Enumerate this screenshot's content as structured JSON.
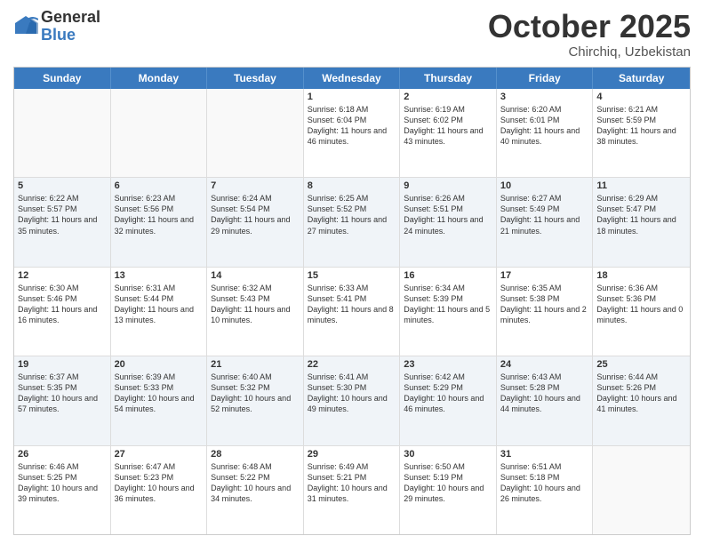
{
  "logo": {
    "general": "General",
    "blue": "Blue"
  },
  "header": {
    "month": "October 2025",
    "location": "Chirchiq, Uzbekistan"
  },
  "days": [
    "Sunday",
    "Monday",
    "Tuesday",
    "Wednesday",
    "Thursday",
    "Friday",
    "Saturday"
  ],
  "rows": [
    [
      {
        "day": "",
        "empty": true
      },
      {
        "day": "",
        "empty": true
      },
      {
        "day": "",
        "empty": true
      },
      {
        "day": "1",
        "sunrise": "6:18 AM",
        "sunset": "6:04 PM",
        "daylight": "11 hours and 46 minutes."
      },
      {
        "day": "2",
        "sunrise": "6:19 AM",
        "sunset": "6:02 PM",
        "daylight": "11 hours and 43 minutes."
      },
      {
        "day": "3",
        "sunrise": "6:20 AM",
        "sunset": "6:01 PM",
        "daylight": "11 hours and 40 minutes."
      },
      {
        "day": "4",
        "sunrise": "6:21 AM",
        "sunset": "5:59 PM",
        "daylight": "11 hours and 38 minutes."
      }
    ],
    [
      {
        "day": "5",
        "sunrise": "6:22 AM",
        "sunset": "5:57 PM",
        "daylight": "11 hours and 35 minutes."
      },
      {
        "day": "6",
        "sunrise": "6:23 AM",
        "sunset": "5:56 PM",
        "daylight": "11 hours and 32 minutes."
      },
      {
        "day": "7",
        "sunrise": "6:24 AM",
        "sunset": "5:54 PM",
        "daylight": "11 hours and 29 minutes."
      },
      {
        "day": "8",
        "sunrise": "6:25 AM",
        "sunset": "5:52 PM",
        "daylight": "11 hours and 27 minutes."
      },
      {
        "day": "9",
        "sunrise": "6:26 AM",
        "sunset": "5:51 PM",
        "daylight": "11 hours and 24 minutes."
      },
      {
        "day": "10",
        "sunrise": "6:27 AM",
        "sunset": "5:49 PM",
        "daylight": "11 hours and 21 minutes."
      },
      {
        "day": "11",
        "sunrise": "6:29 AM",
        "sunset": "5:47 PM",
        "daylight": "11 hours and 18 minutes."
      }
    ],
    [
      {
        "day": "12",
        "sunrise": "6:30 AM",
        "sunset": "5:46 PM",
        "daylight": "11 hours and 16 minutes."
      },
      {
        "day": "13",
        "sunrise": "6:31 AM",
        "sunset": "5:44 PM",
        "daylight": "11 hours and 13 minutes."
      },
      {
        "day": "14",
        "sunrise": "6:32 AM",
        "sunset": "5:43 PM",
        "daylight": "11 hours and 10 minutes."
      },
      {
        "day": "15",
        "sunrise": "6:33 AM",
        "sunset": "5:41 PM",
        "daylight": "11 hours and 8 minutes."
      },
      {
        "day": "16",
        "sunrise": "6:34 AM",
        "sunset": "5:39 PM",
        "daylight": "11 hours and 5 minutes."
      },
      {
        "day": "17",
        "sunrise": "6:35 AM",
        "sunset": "5:38 PM",
        "daylight": "11 hours and 2 minutes."
      },
      {
        "day": "18",
        "sunrise": "6:36 AM",
        "sunset": "5:36 PM",
        "daylight": "11 hours and 0 minutes."
      }
    ],
    [
      {
        "day": "19",
        "sunrise": "6:37 AM",
        "sunset": "5:35 PM",
        "daylight": "10 hours and 57 minutes."
      },
      {
        "day": "20",
        "sunrise": "6:39 AM",
        "sunset": "5:33 PM",
        "daylight": "10 hours and 54 minutes."
      },
      {
        "day": "21",
        "sunrise": "6:40 AM",
        "sunset": "5:32 PM",
        "daylight": "10 hours and 52 minutes."
      },
      {
        "day": "22",
        "sunrise": "6:41 AM",
        "sunset": "5:30 PM",
        "daylight": "10 hours and 49 minutes."
      },
      {
        "day": "23",
        "sunrise": "6:42 AM",
        "sunset": "5:29 PM",
        "daylight": "10 hours and 46 minutes."
      },
      {
        "day": "24",
        "sunrise": "6:43 AM",
        "sunset": "5:28 PM",
        "daylight": "10 hours and 44 minutes."
      },
      {
        "day": "25",
        "sunrise": "6:44 AM",
        "sunset": "5:26 PM",
        "daylight": "10 hours and 41 minutes."
      }
    ],
    [
      {
        "day": "26",
        "sunrise": "6:46 AM",
        "sunset": "5:25 PM",
        "daylight": "10 hours and 39 minutes."
      },
      {
        "day": "27",
        "sunrise": "6:47 AM",
        "sunset": "5:23 PM",
        "daylight": "10 hours and 36 minutes."
      },
      {
        "day": "28",
        "sunrise": "6:48 AM",
        "sunset": "5:22 PM",
        "daylight": "10 hours and 34 minutes."
      },
      {
        "day": "29",
        "sunrise": "6:49 AM",
        "sunset": "5:21 PM",
        "daylight": "10 hours and 31 minutes."
      },
      {
        "day": "30",
        "sunrise": "6:50 AM",
        "sunset": "5:19 PM",
        "daylight": "10 hours and 29 minutes."
      },
      {
        "day": "31",
        "sunrise": "6:51 AM",
        "sunset": "5:18 PM",
        "daylight": "10 hours and 26 minutes."
      },
      {
        "day": "",
        "empty": true
      }
    ]
  ]
}
